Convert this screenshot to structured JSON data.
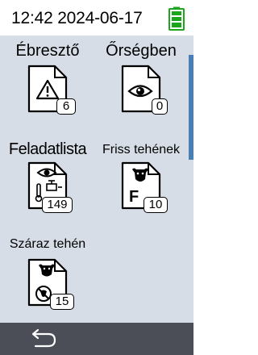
{
  "status": {
    "time": "12:42",
    "date": "2024-06-17",
    "battery_icon": "battery-full-icon",
    "battery_color": "#1ea51e"
  },
  "tiles": [
    {
      "label": "Ébresztő",
      "icon": "warning-icon",
      "count": "6"
    },
    {
      "label": "Őrségben",
      "icon": "eye-icon",
      "count": "0"
    },
    {
      "label": "Feladatlista",
      "icon": "eye-thermometer-syringe-icon",
      "count": "149"
    },
    {
      "label": "Friss tehének",
      "icon": "cow-f-icon",
      "count": "10"
    },
    {
      "label": "Száraz tehén",
      "icon": "cow-dry-icon",
      "count": "15"
    }
  ],
  "colors": {
    "content_background": "#d6dde6",
    "scrollbar": "#4a7fb6",
    "bottom_bar": "#4b4e57"
  },
  "bottom": {
    "back_icon": "back-arrow-icon"
  }
}
